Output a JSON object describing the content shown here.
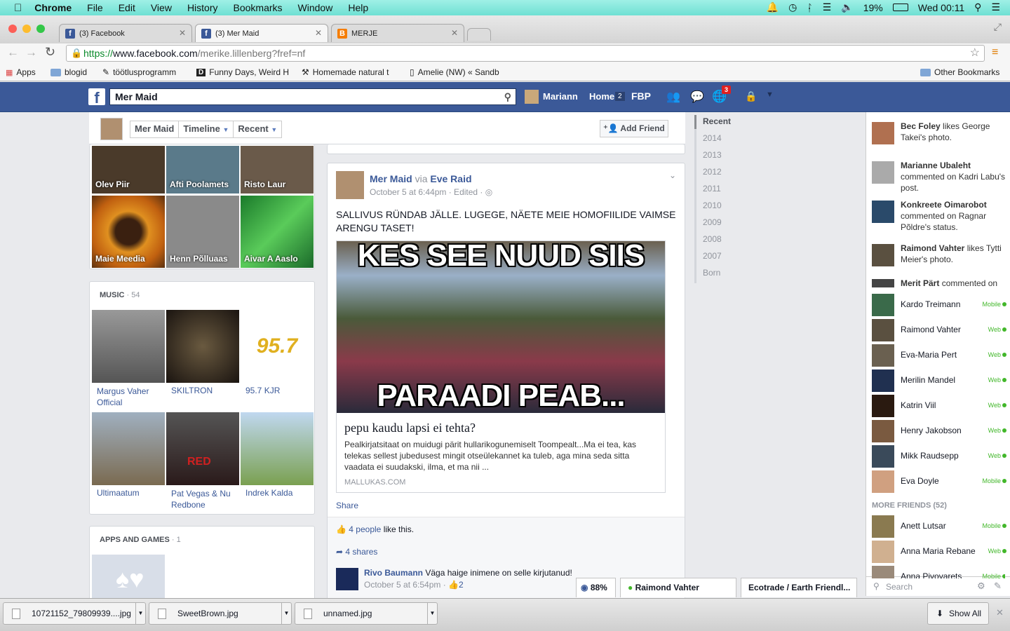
{
  "menubar": {
    "app": "Chrome",
    "items": [
      "File",
      "Edit",
      "View",
      "History",
      "Bookmarks",
      "Window",
      "Help"
    ],
    "battery": "19%",
    "clock": "Wed 00:11"
  },
  "tabs": [
    {
      "title": "(3) Facebook",
      "icon": "facebook-icon",
      "color": "#3b5998"
    },
    {
      "title": "(3) Mer Maid",
      "icon": "facebook-icon",
      "color": "#3b5998"
    },
    {
      "title": "MERJE",
      "icon": "blogger-icon",
      "color": "#f57d00"
    }
  ],
  "url": {
    "scheme": "https://",
    "host": "www.facebook.com",
    "path": "/merike.lillenberg?fref=nf"
  },
  "bookmarks": [
    "Apps",
    "blogid",
    "töötlusprogramm",
    "Funny Days, Weird H",
    "Homemade natural t",
    "Amelie (NW) « Sandb"
  ],
  "other_bookmarks": "Other Bookmarks",
  "fb": {
    "search": "Mer Maid",
    "user": "Mariann",
    "home": "Home",
    "home_count": "2",
    "fbp": "FBP",
    "notif_count": "3"
  },
  "profile_nav": {
    "name": "Mer Maid",
    "timeline": "Timeline",
    "recent": "Recent",
    "add_friend": "Add Friend"
  },
  "friends": [
    {
      "name": "Olev Piir",
      "color": "#4a3a2a"
    },
    {
      "name": "Afti Poolamets",
      "color": "#5a7a8a"
    },
    {
      "name": "Risto Laur",
      "color": "#6a5a4a"
    },
    {
      "name": "Maie Meedia",
      "color": "#c0601a"
    },
    {
      "name": "Henn Põlluaas",
      "color": "#8a8a8a"
    },
    {
      "name": "Aivar A Aaslo",
      "color": "#2a9a3a"
    }
  ],
  "music": {
    "header": "MUSIC",
    "count": "54",
    "items": [
      {
        "name": "Margus Vaher Official",
        "color": "#777"
      },
      {
        "name": "SKILTRON",
        "color": "#2a2420"
      },
      {
        "name": "95.7 KJR",
        "color": "#f5f5f5"
      },
      {
        "name": "Ultimaatum",
        "color": "#7a6a50"
      },
      {
        "name": "Pat Vegas & Nu Redbone",
        "color": "#3a2a2a"
      },
      {
        "name": "Indrek Kalda",
        "color": "#6a9a50"
      }
    ]
  },
  "apps": {
    "header": "APPS AND GAMES",
    "count": "1"
  },
  "post": {
    "author": "Mer Maid",
    "via": "via",
    "via_name": "Eve Raid",
    "meta": "October 5 at 6:44pm · Edited ·",
    "text": "SALLIVUS RÜNDAB JÄLLE. LUGEGE, NÄETE MEIE HOMOFIILIDE VAIMSE ARENGU TASET!",
    "img_top": "KES SEE NUUD SIIS",
    "img_bottom": "PARAADI PEAB...",
    "link_title": "pepu kaudu lapsi ei tehta?",
    "link_desc": "Pealkirjatsitaat on muidugi pärit hullarikogunemiselt Toompealt...Ma ei tea, kas telekas sellest jubedusest mingit otseülekannet ka tuleb, aga mina seda sitta vaadata ei suudakski, ilma, et ma nii ...",
    "link_domain": "MALLUKAS.COM",
    "share": "Share",
    "likes_link": "4 people",
    "likes_rest": "like this.",
    "shares": "4 shares",
    "comment_author": "Rivo Baumann",
    "comment_text": "Väga haige inimene on selle kirjutanud!",
    "comment_meta": "October 5 at 6:54pm ·",
    "comment_likes": "2"
  },
  "years": [
    "Recent",
    "2014",
    "2013",
    "2012",
    "2011",
    "2010",
    "2009",
    "2008",
    "2007",
    "Born"
  ],
  "ticker": [
    {
      "name": "Bec Foley",
      "rest": "likes George Takei's photo.",
      "color": "#b07050"
    },
    {
      "name": "Marianne Ubaleht",
      "rest": "commented on Kadri Labu's post.",
      "color": "#aaa"
    },
    {
      "name": "Konkreete Oimarobot",
      "rest": "commented on Ragnar Põldre's status.",
      "color": "#2a4a6a"
    },
    {
      "name": "Raimond Vahter",
      "rest": "likes Tytti Meier's photo.",
      "color": "#5a5040"
    },
    {
      "name": "Merit Pärt",
      "rest": "commented on",
      "color": "#444"
    }
  ],
  "online": [
    {
      "name": "Kardo Treimann",
      "status": "Mobile",
      "color": "#3a6a4a"
    },
    {
      "name": "Raimond Vahter",
      "status": "Web",
      "color": "#5a5040"
    },
    {
      "name": "Eva-Maria Pert",
      "status": "Web",
      "color": "#6a6050"
    },
    {
      "name": "Merilin Mandel",
      "status": "Web",
      "color": "#203050"
    },
    {
      "name": "Katrin Viil",
      "status": "Web",
      "color": "#2a1a10"
    },
    {
      "name": "Henry Jakobson",
      "status": "Web",
      "color": "#7a5a40"
    },
    {
      "name": "Mikk Raudsepp",
      "status": "Web",
      "color": "#3a4a5a"
    },
    {
      "name": "Eva Doyle",
      "status": "Mobile",
      "color": "#d0a080"
    }
  ],
  "more_friends": "MORE FRIENDS (52)",
  "more": [
    {
      "name": "Anett Lutsar",
      "status": "Mobile",
      "color": "#8a7a50"
    },
    {
      "name": "Anna Maria Rebane",
      "status": "Web",
      "color": "#d0b090"
    },
    {
      "name": "Anna Pivovarets",
      "status": "Mobile",
      "color": "#9a8a7a"
    }
  ],
  "chat_search": "Search",
  "chatbars": {
    "pct": "88%",
    "c1": "Raimond Vahter",
    "c2": "Ecotrade / Earth Friendl..."
  },
  "downloads": [
    "10721152_79809939....jpg",
    "SweetBrown.jpg",
    "unnamed.jpg"
  ],
  "show_all": "Show All"
}
